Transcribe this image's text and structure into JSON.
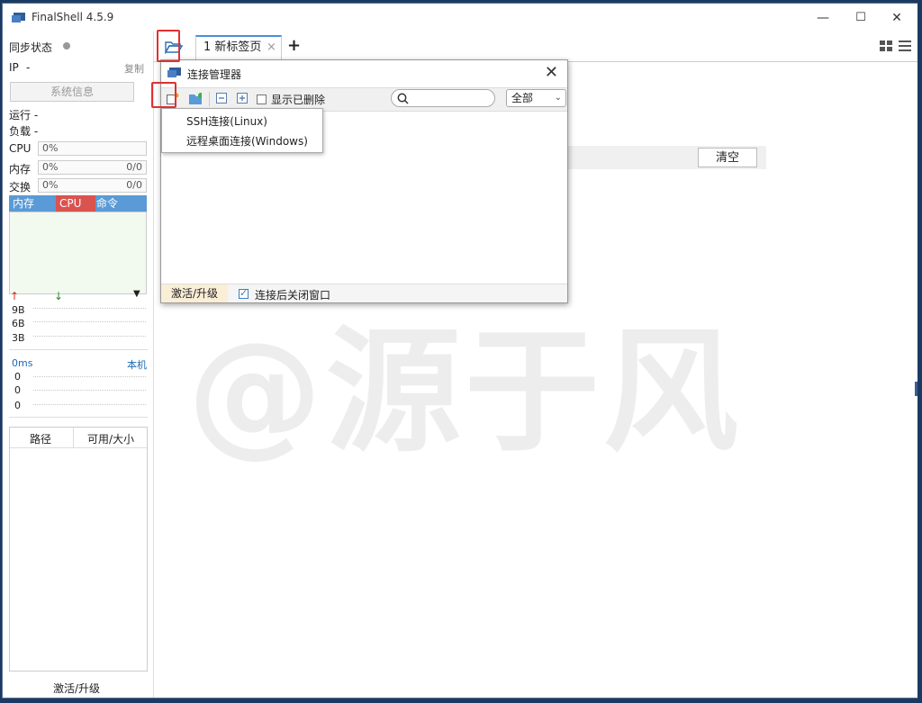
{
  "app": {
    "title": "FinalShell 4.5.9"
  },
  "window_controls": {
    "minimize": "—",
    "maximize": "☐",
    "close": "✕"
  },
  "sidebar": {
    "sync_status": "同步状态",
    "ip_label": "IP",
    "ip_value": "-",
    "copy": "复制",
    "sys_info": "系统信息",
    "running": "运行 -",
    "load": "负载 -",
    "cpu_label": "CPU",
    "cpu_value": "0%",
    "mem_label": "内存",
    "mem_value": "0%",
    "mem_ratio": "0/0",
    "swap_label": "交换",
    "swap_value": "0%",
    "swap_ratio": "0/0",
    "proc_tabs": [
      "内存",
      "CPU",
      "命令"
    ],
    "net_labels": [
      "9B",
      "6B",
      "3B"
    ],
    "latency": "0ms",
    "local": "本机",
    "latency_vals": [
      "0",
      "0",
      "0"
    ],
    "disk_headers": [
      "路径",
      "可用/大小"
    ],
    "activate": "激活/升级"
  },
  "tabs": {
    "tab1": "1 新标签页",
    "close": "×",
    "add": "+"
  },
  "main": {
    "clear_button": "清空",
    "watermark": "@源于风"
  },
  "dialog": {
    "title": "连接管理器",
    "close": "✕",
    "show_deleted": "显示已删除",
    "search_placeholder": "",
    "filter": "全部",
    "activate": "激活/升级",
    "close_after_connect": "连接后关闭窗口"
  },
  "new_menu": {
    "items": [
      "SSH连接(Linux)",
      "远程桌面连接(Windows)"
    ]
  },
  "colors": {
    "accent": "#4a90d9",
    "highlight": "#e03030",
    "cpu_tab": "#d9534f",
    "proc_head": "#5a9ad6"
  }
}
